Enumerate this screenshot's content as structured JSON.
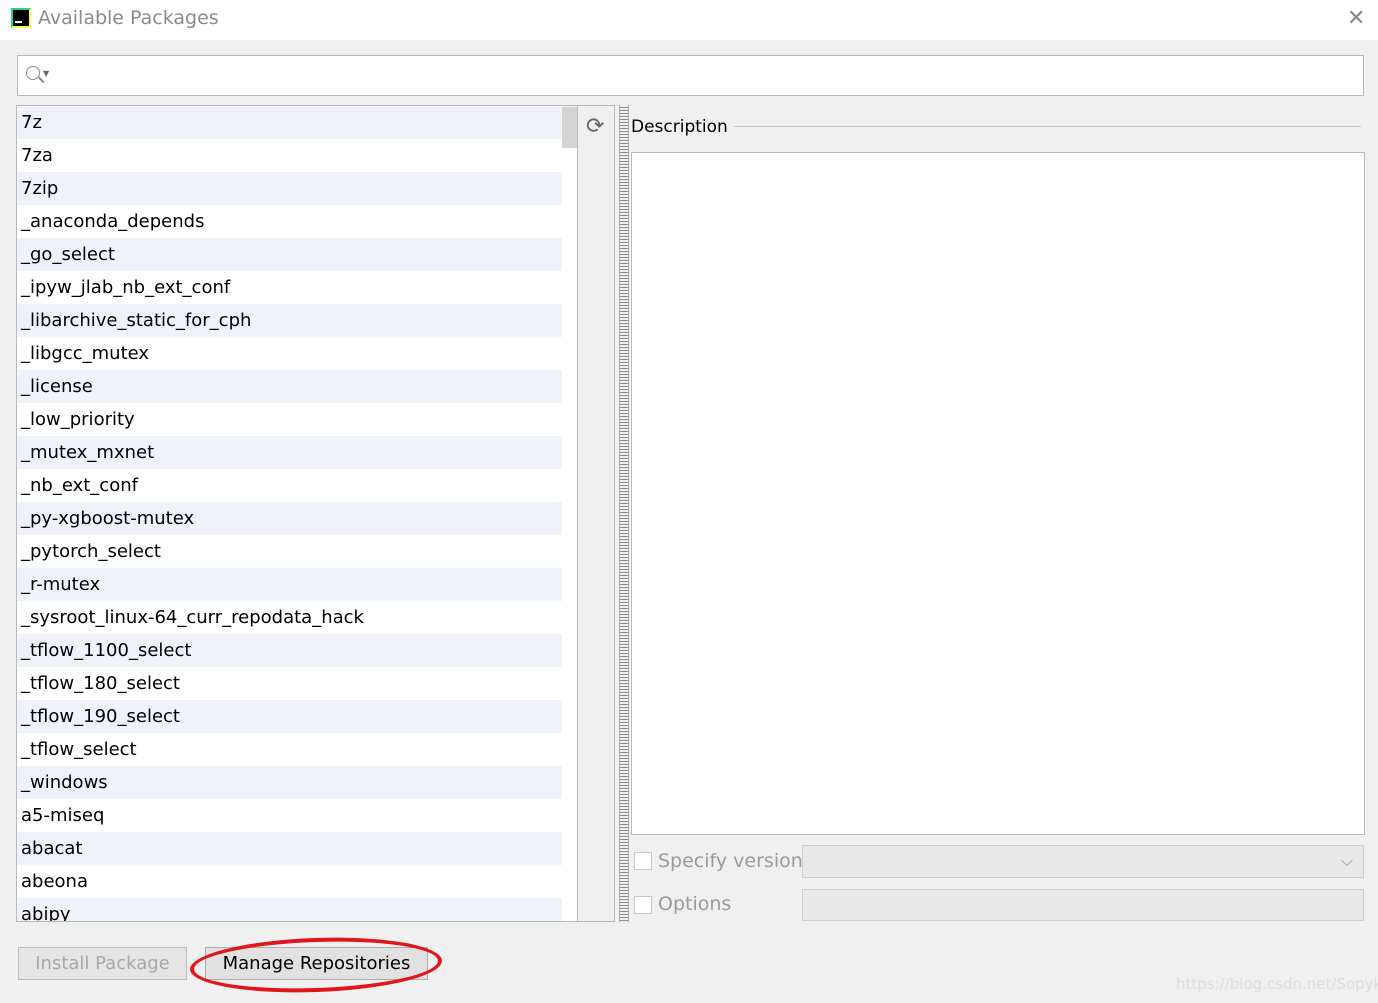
{
  "window": {
    "title": "Available Packages",
    "logo_text": "PC",
    "close_icon": "close-icon"
  },
  "search": {
    "value": "",
    "placeholder": ""
  },
  "packages": [
    "7z",
    "7za",
    "7zip",
    "_anaconda_depends",
    "_go_select",
    "_ipyw_jlab_nb_ext_conf",
    "_libarchive_static_for_cph",
    "_libgcc_mutex",
    "_license",
    "_low_priority",
    "_mutex_mxnet",
    "_nb_ext_conf",
    "_py-xgboost-mutex",
    "_pytorch_select",
    "_r-mutex",
    "_sysroot_linux-64_curr_repodata_hack",
    "_tflow_1100_select",
    "_tflow_180_select",
    "_tflow_190_select",
    "_tflow_select",
    "_windows",
    "a5-miseq",
    "abacat",
    "abeona",
    "abipy"
  ],
  "description": {
    "label": "Description",
    "text": ""
  },
  "options": {
    "specify_version": "Specify version",
    "specify_version_checked": false,
    "version_value": "",
    "options_label": "Options",
    "options_checked": false,
    "options_value": ""
  },
  "buttons": {
    "install": "Install Package",
    "manage": "Manage Repositories"
  },
  "annotation_color": "#e0161c",
  "watermark": "https://blog.csdn.net/Sopyki"
}
